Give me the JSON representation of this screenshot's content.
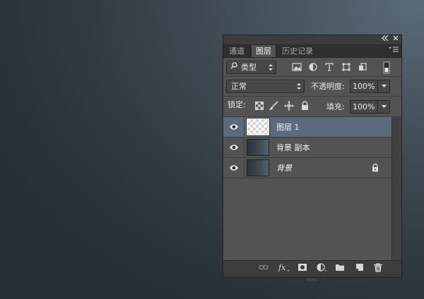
{
  "panel": {
    "titlebar": {
      "collapse_icon": "double-chevron-left",
      "close_icon": "close-x"
    },
    "tabs": [
      {
        "label": "通道",
        "active": false
      },
      {
        "label": "图层",
        "active": true
      },
      {
        "label": "历史记录",
        "active": false
      }
    ],
    "menu_icon": "panel-menu"
  },
  "filter": {
    "kind_label": "类型",
    "icons": [
      "pixel-layer-filter",
      "adjustment-layer-filter",
      "type-layer-filter",
      "shape-layer-filter",
      "smart-object-filter",
      "filter-toggle"
    ]
  },
  "blend": {
    "mode": "正常",
    "opacity_label": "不透明度:",
    "opacity_value": "100%"
  },
  "lock": {
    "label": "锁定:",
    "icons": [
      "lock-transparent-pixels",
      "lock-image-pixels",
      "lock-position",
      "lock-all"
    ],
    "fill_label": "填充:",
    "fill_value": "100%"
  },
  "layers": [
    {
      "name": "图层 1",
      "thumb": "transparent",
      "selected": true,
      "visible": true,
      "locked": false,
      "italic": false
    },
    {
      "name": "背景 副本",
      "thumb": "gradient",
      "selected": false,
      "visible": true,
      "locked": false,
      "italic": false
    },
    {
      "name": "背景",
      "thumb": "gradient",
      "selected": false,
      "visible": true,
      "locked": true,
      "italic": true
    }
  ],
  "bottom_icons": [
    "link-layers",
    "fx-layer-style",
    "add-mask",
    "new-adjustment-layer",
    "new-group",
    "new-layer",
    "delete-layer"
  ],
  "colors": {
    "selected_row": "#5b6b7d",
    "panel_bg": "#535353",
    "dark_bg": "#2c343c"
  }
}
